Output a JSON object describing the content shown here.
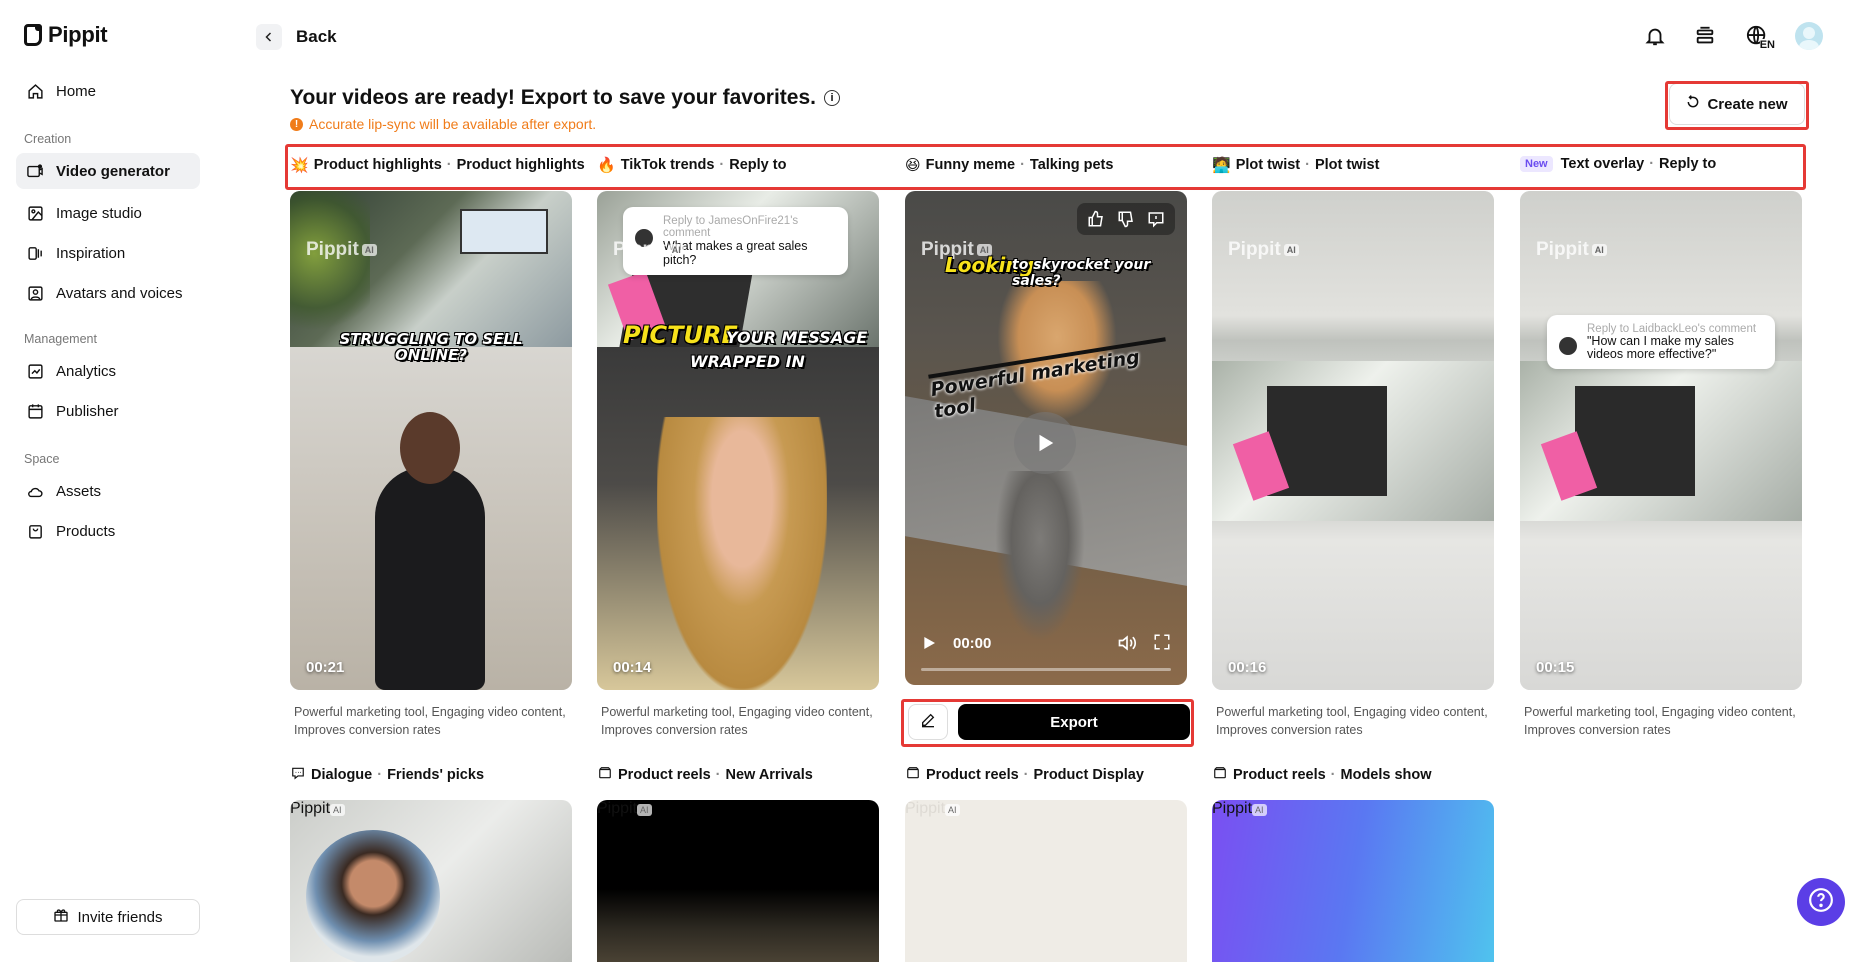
{
  "app": {
    "name": "Pippit"
  },
  "sidebar": {
    "home": "Home",
    "sections": {
      "creation": "Creation",
      "management": "Management",
      "space": "Space"
    },
    "items": [
      {
        "label": "Home",
        "icon": "home-icon"
      },
      {
        "label": "Video generator",
        "icon": "video-generator-icon",
        "active": true
      },
      {
        "label": "Image studio",
        "icon": "image-icon"
      },
      {
        "label": "Inspiration",
        "icon": "inspiration-icon"
      },
      {
        "label": "Avatars and voices",
        "icon": "avatar-icon"
      },
      {
        "label": "Analytics",
        "icon": "analytics-icon"
      },
      {
        "label": "Publisher",
        "icon": "calendar-icon"
      },
      {
        "label": "Assets",
        "icon": "cloud-icon"
      },
      {
        "label": "Products",
        "icon": "bag-icon"
      }
    ],
    "invite": "Invite friends"
  },
  "topbar": {
    "back": "Back",
    "lang": "EN"
  },
  "main": {
    "headline": "Your videos are ready! Export to save your favorites.",
    "notice": "Accurate lip-sync will be available after export.",
    "create_new": "Create new"
  },
  "tags": [
    {
      "emoji": "💥",
      "category": "Product highlights",
      "style": "Product highlights"
    },
    {
      "emoji": "🔥",
      "category": "TikTok trends",
      "style": "Reply to"
    },
    {
      "emoji": "😆",
      "category": "Funny meme",
      "style": "Talking pets"
    },
    {
      "emoji": "🧑‍💻",
      "category": "Plot twist",
      "style": "Plot twist"
    },
    {
      "badge": "New",
      "category": "Text overlay",
      "style": "Reply to"
    }
  ],
  "cards": [
    {
      "duration": "00:21",
      "caption": "STRUGGLING TO SELL ONLINE?"
    },
    {
      "duration": "00:14",
      "comment_head": "Reply to JamesOnFire21's comment",
      "comment_text": "What makes a great sales pitch?",
      "caption_a": "PICTURE",
      "caption_b": "YOUR MESSAGE",
      "caption_c": "WRAPPED IN"
    },
    {
      "time": "00:00",
      "caption_a": "Looking",
      "caption_b": "to skyrocket your sales?",
      "caption_c": "Powerful marketing tool"
    },
    {
      "duration": "00:16"
    },
    {
      "duration": "00:15",
      "comment_head": "Reply to LaidbackLeo's comment",
      "comment_text": "\"How can I make my sales videos more effective?\""
    }
  ],
  "watermark": "Pippit",
  "watermark_badge": "AI",
  "description": "Powerful marketing tool, Engaging video content, Improves conversion rates",
  "export_label": "Export",
  "tags2": [
    {
      "category": "Dialogue",
      "style": "Friends' picks",
      "icon": "chat-icon"
    },
    {
      "category": "Product reels",
      "style": "New Arrivals",
      "icon": "reel-icon"
    },
    {
      "category": "Product reels",
      "style": "Product Display",
      "icon": "reel-icon"
    },
    {
      "category": "Product reels",
      "style": "Models show",
      "icon": "reel-icon"
    }
  ],
  "colors": {
    "accent": "#5b3ee6",
    "warning": "#f07c1a",
    "highlight": "#e53935"
  }
}
